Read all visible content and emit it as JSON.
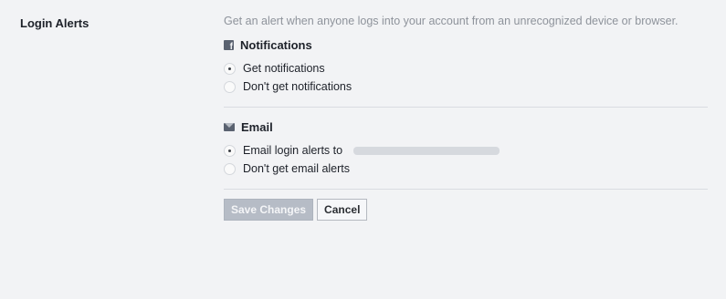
{
  "section": {
    "label": "Login Alerts",
    "description": "Get an alert when anyone logs into your account from an unrecognized device or browser."
  },
  "notifications": {
    "icon": "facebook-icon",
    "title": "Notifications",
    "options": [
      {
        "label": "Get notifications",
        "checked": true
      },
      {
        "label": "Don't get notifications",
        "checked": false
      }
    ]
  },
  "email": {
    "icon": "mail-icon",
    "title": "Email",
    "options": [
      {
        "label": "Email login alerts to",
        "checked": true
      },
      {
        "label": "Don't get email alerts",
        "checked": false
      }
    ]
  },
  "actions": {
    "save_label": "Save Changes",
    "cancel_label": "Cancel"
  }
}
